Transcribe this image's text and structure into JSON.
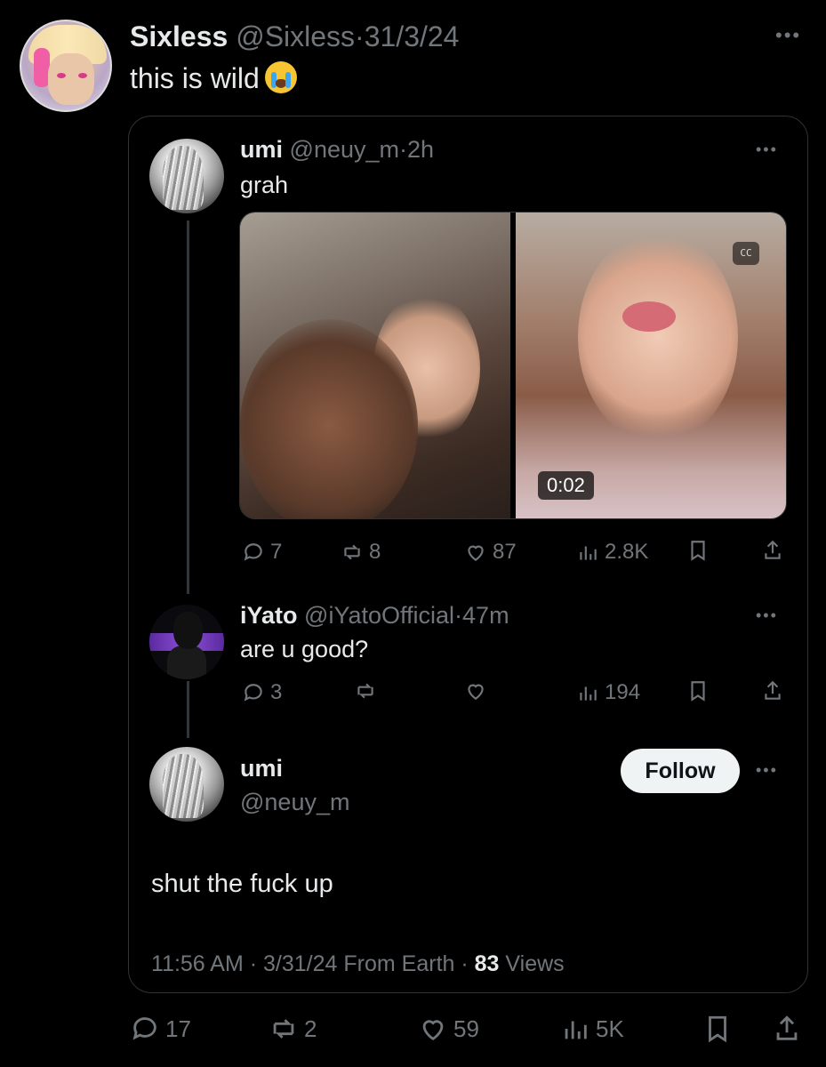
{
  "outer": {
    "name": "Sixless",
    "handle": "@Sixless",
    "date": "31/3/24",
    "text": "this is wild",
    "emoji": "loudly-crying-face-emoji",
    "stats": {
      "replies": "17",
      "reposts": "2",
      "likes": "59",
      "views": "5K"
    }
  },
  "quote": {
    "tweet1": {
      "name": "umi",
      "handle": "@neuy_m",
      "time": "2h",
      "text": "grah",
      "video_time": "0:02",
      "stats": {
        "replies": "7",
        "reposts": "8",
        "likes": "87",
        "views": "2.8K"
      }
    },
    "tweet2": {
      "name": "iYato",
      "handle": "@iYatoOfficial",
      "time": "47m",
      "text": "are u good?",
      "stats": {
        "replies": "3",
        "views": "194"
      }
    },
    "tweet3": {
      "name": "umi",
      "handle": "@neuy_m",
      "follow_label": "Follow",
      "text": "shut the fuck up",
      "time": "11:56 AM",
      "date": "3/31/24",
      "source": "From Earth",
      "views_count": "83",
      "views_label": "Views"
    }
  },
  "sep": "·",
  "more": "•••",
  "cc": "CC"
}
